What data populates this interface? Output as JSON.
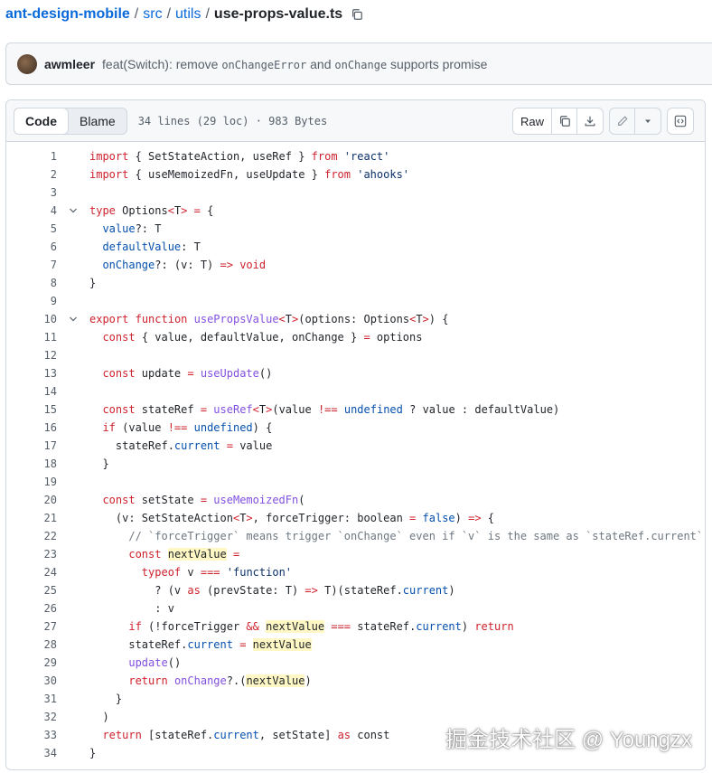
{
  "breadcrumb": {
    "repo": "ant-design-mobile",
    "dir1": "src",
    "dir2": "utils",
    "file": "use-props-value.ts",
    "sep": "/"
  },
  "commit": {
    "author": "awmleer",
    "msg_pre": "feat(Switch): remove ",
    "msg_code1": "onChangeError",
    "msg_mid": " and ",
    "msg_code2": "onChange",
    "msg_post": " supports promise"
  },
  "file_header": {
    "tab_code": "Code",
    "tab_blame": "Blame",
    "info": "34 lines (29 loc) · 983 Bytes",
    "raw_label": "Raw"
  },
  "code_lines": [
    [
      [
        "k",
        "import"
      ],
      [
        "",
        "{ SetStateAction, useRef } "
      ],
      [
        "k",
        "from"
      ],
      [
        "",
        " "
      ],
      [
        "s",
        "'react'"
      ]
    ],
    [
      [
        "k",
        "import"
      ],
      [
        "",
        "{ useMemoizedFn, useUpdate } "
      ],
      [
        "k",
        "from"
      ],
      [
        "",
        " "
      ],
      [
        "s",
        "'ahooks'"
      ]
    ],
    [],
    [
      [
        "k",
        "type"
      ],
      [
        "",
        " Options"
      ],
      [
        "k",
        "<"
      ],
      [
        "",
        "T"
      ],
      [
        "k",
        ">"
      ],
      [
        "",
        " "
      ],
      [
        "k",
        "="
      ],
      [
        "",
        " {"
      ]
    ],
    [
      [
        "",
        "  "
      ],
      [
        "cn",
        "value"
      ],
      [
        "",
        "?: T"
      ]
    ],
    [
      [
        "",
        "  "
      ],
      [
        "cn",
        "defaultValue"
      ],
      [
        "",
        ": T"
      ]
    ],
    [
      [
        "",
        "  "
      ],
      [
        "cn",
        "onChange"
      ],
      [
        "",
        "?: (v: T) "
      ],
      [
        "k",
        "=>"
      ],
      [
        "",
        " "
      ],
      [
        "k",
        "void"
      ]
    ],
    [
      [
        "",
        "}"
      ]
    ],
    [],
    [
      [
        "k",
        "export"
      ],
      [
        "",
        " "
      ],
      [
        "k",
        "function"
      ],
      [
        "",
        " "
      ],
      [
        "f",
        "usePropsValue"
      ],
      [
        "k",
        "<"
      ],
      [
        "",
        "T"
      ],
      [
        "k",
        ">"
      ],
      [
        "",
        "(options: Options"
      ],
      [
        "k",
        "<"
      ],
      [
        "",
        "T"
      ],
      [
        "k",
        ">"
      ],
      [
        "",
        ") {"
      ]
    ],
    [
      [
        "",
        "  "
      ],
      [
        "k",
        "const"
      ],
      [
        "",
        "{ value, defaultValue, onChange } "
      ],
      [
        "k",
        "="
      ],
      [
        "",
        " options"
      ]
    ],
    [],
    [
      [
        "",
        "  "
      ],
      [
        "k",
        "const"
      ],
      [
        "",
        " update "
      ],
      [
        "k",
        "="
      ],
      [
        "",
        " "
      ],
      [
        "f",
        "useUpdate"
      ],
      [
        "",
        "()"
      ]
    ],
    [],
    [
      [
        "",
        "  "
      ],
      [
        "k",
        "const"
      ],
      [
        "",
        " stateRef "
      ],
      [
        "k",
        "="
      ],
      [
        "",
        " "
      ],
      [
        "f",
        "useRef"
      ],
      [
        "k",
        "<"
      ],
      [
        "",
        "T"
      ],
      [
        "k",
        ">"
      ],
      [
        "",
        "(value "
      ],
      [
        "k",
        "!=="
      ],
      [
        "",
        " "
      ],
      [
        "cn",
        "undefined"
      ],
      [
        "",
        " ? value : defaultValue)"
      ]
    ],
    [
      [
        "",
        "  "
      ],
      [
        "k",
        "if"
      ],
      [
        "",
        " (value "
      ],
      [
        "k",
        "!=="
      ],
      [
        "",
        " "
      ],
      [
        "cn",
        "undefined"
      ],
      [
        "",
        ") {"
      ]
    ],
    [
      [
        "",
        "    stateRef."
      ],
      [
        "cn",
        "current"
      ],
      [
        "",
        " "
      ],
      [
        "k",
        "="
      ],
      [
        "",
        " value"
      ]
    ],
    [
      [
        "",
        "  }"
      ]
    ],
    [],
    [
      [
        "",
        "  "
      ],
      [
        "k",
        "const"
      ],
      [
        "",
        " setState "
      ],
      [
        "k",
        "="
      ],
      [
        "",
        " "
      ],
      [
        "f",
        "useMemoizedFn"
      ],
      [
        "",
        "("
      ]
    ],
    [
      [
        "",
        "    (v: SetStateAction"
      ],
      [
        "k",
        "<"
      ],
      [
        "",
        "T"
      ],
      [
        "k",
        ">"
      ],
      [
        "",
        ", forceTrigger: boolean "
      ],
      [
        "k",
        "="
      ],
      [
        "",
        " "
      ],
      [
        "cn",
        "false"
      ],
      [
        "",
        ") "
      ],
      [
        "k",
        "=>"
      ],
      [
        "",
        " {"
      ]
    ],
    [
      [
        "",
        "      "
      ],
      [
        "c",
        "// `forceTrigger` means trigger `onChange` even if `v` is the same as `stateRef.current`"
      ]
    ],
    [
      [
        "",
        "      "
      ],
      [
        "k",
        "const"
      ],
      [
        "",
        " "
      ],
      [
        "hl",
        "nextValue"
      ],
      [
        "",
        " "
      ],
      [
        "k",
        "="
      ]
    ],
    [
      [
        "",
        "        "
      ],
      [
        "k",
        "typeof"
      ],
      [
        "",
        " v "
      ],
      [
        "k",
        "==="
      ],
      [
        "",
        " "
      ],
      [
        "s",
        "'function'"
      ]
    ],
    [
      [
        "",
        "          ? (v "
      ],
      [
        "k",
        "as"
      ],
      [
        "",
        " (prevState: T) "
      ],
      [
        "k",
        "=>"
      ],
      [
        "",
        " T)(stateRef."
      ],
      [
        "cn",
        "current"
      ],
      [
        "",
        ")"
      ]
    ],
    [
      [
        "",
        "          : v"
      ]
    ],
    [
      [
        "",
        "      "
      ],
      [
        "k",
        "if"
      ],
      [
        "",
        " (!forceTrigger "
      ],
      [
        "k",
        "&&"
      ],
      [
        "",
        " "
      ],
      [
        "hl",
        "nextValue"
      ],
      [
        "",
        " "
      ],
      [
        "k",
        "==="
      ],
      [
        "",
        " stateRef."
      ],
      [
        "cn",
        "current"
      ],
      [
        "",
        ") "
      ],
      [
        "k",
        "return"
      ]
    ],
    [
      [
        "",
        "      stateRef."
      ],
      [
        "cn",
        "current"
      ],
      [
        "",
        " "
      ],
      [
        "k",
        "="
      ],
      [
        "",
        " "
      ],
      [
        "hl",
        "nextValue"
      ]
    ],
    [
      [
        "",
        "      "
      ],
      [
        "f",
        "update"
      ],
      [
        "",
        "()"
      ]
    ],
    [
      [
        "",
        "      "
      ],
      [
        "k",
        "return"
      ],
      [
        "",
        " "
      ],
      [
        "f",
        "onChange"
      ],
      [
        "",
        "?.("
      ],
      [
        "hl",
        "nextValue"
      ],
      [
        "",
        ")"
      ]
    ],
    [
      [
        "",
        "    }"
      ]
    ],
    [
      [
        "",
        "  )"
      ]
    ],
    [
      [
        "",
        "  "
      ],
      [
        "k",
        "return"
      ],
      [
        "",
        " [stateRef."
      ],
      [
        "cn",
        "current"
      ],
      [
        "",
        ", setState] "
      ],
      [
        "k",
        "as"
      ],
      [
        "",
        " const"
      ]
    ],
    [
      [
        "",
        "}"
      ]
    ]
  ],
  "fold_lines": [
    4,
    10
  ],
  "watermark": "掘金技术社区 @ Youngzx"
}
